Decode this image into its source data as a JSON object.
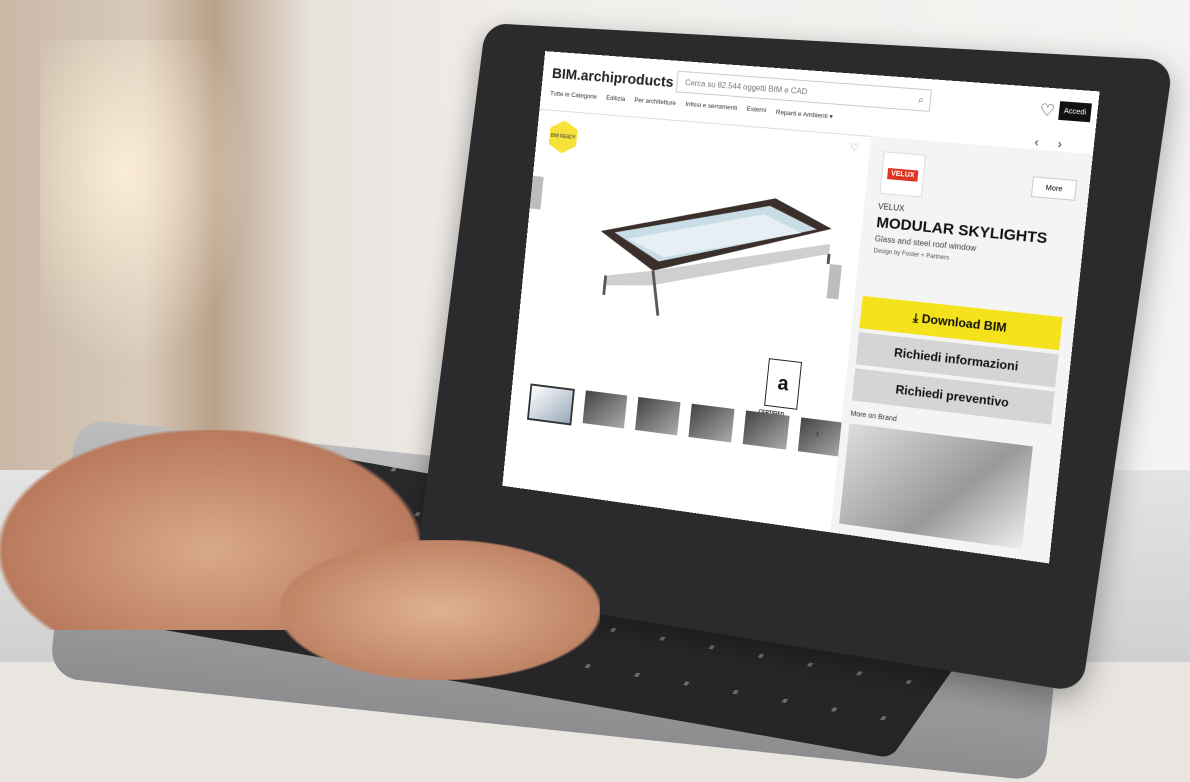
{
  "header": {
    "logo": "BIM.archiproducts",
    "search_placeholder": "Cerca su 82.544 oggetti BIM e CAD",
    "nav": [
      "Tutte le Categorie",
      "Edilizia",
      "Per architetture",
      "Infissi e serramenti",
      "Esterni",
      "Reparti e Ambienti ▾"
    ],
    "login_label": "Accedi"
  },
  "product": {
    "brand_logo": "VELUX",
    "more_label": "More",
    "brand": "VELUX",
    "title": "MODULAR SKYLIGHTS",
    "subtitle": "Glass and steel roof window",
    "designer": "Design by Foster + Partners",
    "bim_badge": "a",
    "bim_badge_caption": "CERTIFIED",
    "badge_text": "BIM READY"
  },
  "actions": {
    "download": "Download BIM",
    "info": "Richiedi informazioni",
    "quote": "Richiedi preventivo"
  },
  "more_brand": "More on Brand",
  "thumbnail_count": 6,
  "colors": {
    "accent": "#F4E21C",
    "button_grey": "#D5D5D5",
    "brand_red": "#D32F2F"
  }
}
